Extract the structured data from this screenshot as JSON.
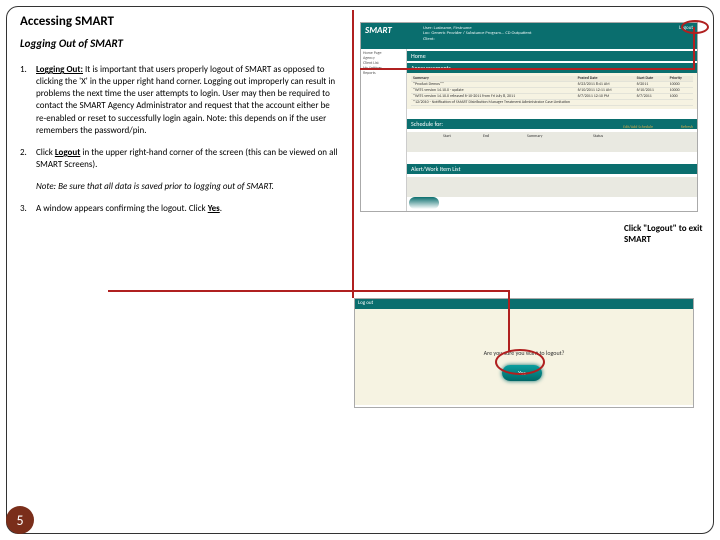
{
  "title": "Accessing SMART",
  "subtitle": "Logging Out of SMART",
  "steps": {
    "s1_num": "1.",
    "s1_lead": "Logging Out:",
    "s1_body": " It is important that users properly logout of SMART as opposed to clicking the 'X' in the upper right hand corner. Logging out improperly can result in problems the next time the user attempts to login. User may then be required to contact the SMART Agency Administrator and request that the account either be re-enabled or reset to successfully login again. Note: this depends on if the user remembers the password/pin.",
    "s2_num": "2.",
    "s2_a": "Click ",
    "s2_link": "Logout",
    "s2_b": " in the upper right-hand corner of the screen (this can be viewed on all SMART Screens).",
    "note_lead": "Note",
    "note_body": ": Be sure that all data is saved prior to logging out of SMART.",
    "s3_num": "3.",
    "s3_a": "A window appears confirming the logout. Click ",
    "s3_link": "Yes",
    "s3_b": "."
  },
  "shot1": {
    "brand": "SMART",
    "user_line1": "User: Lastname, Firstname",
    "user_line2": "Loc: Generic Provider / Substance Program... CD Outpatient",
    "user_line3": "Client:",
    "logout": "Logout",
    "nav1": "Home Page",
    "nav2": "Agency",
    "nav3": "Client List",
    "nav4": "My Settings",
    "nav5": "Reports",
    "sec_home": "Home",
    "sec_ann": "Announcements",
    "ann_col1": "Summary",
    "ann_col2": "Posted Date",
    "ann_col3": "Start Date",
    "ann_col4": "Priority",
    "ann_r1c1": "*Product Demos**",
    "ann_r1c2": "6/23/2011 8:41 AM",
    "ann_r1c3": "6/2011",
    "ann_r1c4": "10000",
    "ann_r2c1": "*WITS version 14.10.0 - update",
    "ann_r2c2": "6/10/2011 12:11 AM",
    "ann_r2c3": "6/10/2011",
    "ann_r2c4": "10000",
    "ann_r3c1": "*WITS version 14.10.0 released 6-10-2011 from Fri July 8, 2011",
    "ann_r3c2": "6/7/2011 12:10 PM",
    "ann_r3c3": "6/7/2011",
    "ann_r3c4": "1000",
    "ann_r4c1": "*12/2010 - Notification of SMART Distribution Manager Treatment Administrator Case Limitation",
    "sec_sched": "Schedule for:",
    "sched_start": "Start",
    "sched_end": "End",
    "sched_summary": "Summary",
    "sched_status": "Status",
    "sched_edit": "Edit/Add Schedule",
    "sched_refresh": "Refresh",
    "sec_alert": "Alert/Work Item List"
  },
  "callouts": {
    "c1": "Click \"Logout\" to exit SMART"
  },
  "shot2": {
    "bar": "Log out",
    "msg": "Are you sure you want to logout?",
    "yes": "Yes"
  },
  "page_number": "5"
}
